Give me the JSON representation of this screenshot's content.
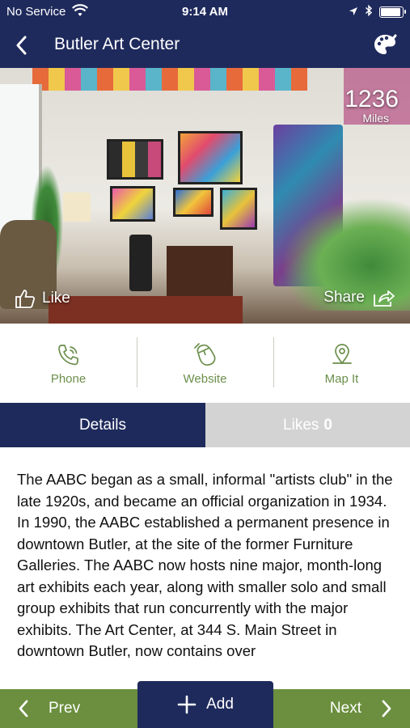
{
  "status_bar": {
    "carrier": "No Service",
    "time": "9:14 AM",
    "wifi_icon": "wifi-icon",
    "location_icon": "location-arrow-icon",
    "bluetooth_icon": "bluetooth-icon",
    "battery_level": 0.92
  },
  "header": {
    "title": "Butler Art Center",
    "back_icon": "chevron-left-icon",
    "action_icon": "palette-icon",
    "background_color": "#1f2a5c"
  },
  "hero": {
    "distance_value": "1236",
    "distance_unit": "Miles",
    "like_label": "Like",
    "share_label": "Share"
  },
  "actions": [
    {
      "label": "Phone",
      "icon": "phone-icon"
    },
    {
      "label": "Website",
      "icon": "mouse-icon"
    },
    {
      "label": "Map It",
      "icon": "map-pin-icon"
    }
  ],
  "tabs": {
    "details_label": "Details",
    "likes_label": "Likes",
    "likes_count": "0",
    "active": "details"
  },
  "description": "The AABC began as a small, informal \"artists club\" in the late 1920s, and became an official organization in 1934. In 1990, the AABC established a permanent presence in downtown Butler, at the site of the former Furniture Galleries. The AABC now hosts nine major, month-long art exhibits each year, along with smaller solo and small group exhibits that run concurrently with the major exhibits. The Art Center, at 344 S. Main Street in downtown Butler, now contains over",
  "bottom_bar": {
    "prev_label": "Prev",
    "add_label": "Add",
    "next_label": "Next",
    "accent_color": "#6b8f3e"
  }
}
